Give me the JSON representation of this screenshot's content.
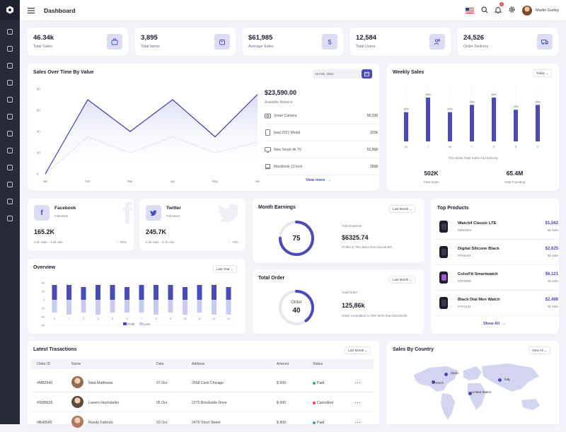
{
  "header": {
    "title": "Dashboard",
    "user_name": "Martin Gurley",
    "notif_count": "4"
  },
  "sidebar": {
    "icons": [
      "monitor-icon",
      "grid-icon",
      "layout-icon",
      "briefcase-icon",
      "pen-icon",
      "database-icon",
      "pie-chart-icon",
      "feather-icon",
      "map-pin-icon",
      "users-icon",
      "archive-icon",
      "share-icon"
    ]
  },
  "stats": [
    {
      "value": "46.34k",
      "label": "Total Sales",
      "icon": "briefcase-icon"
    },
    {
      "value": "3,895",
      "label": "Total Items",
      "icon": "shopping-bag-icon"
    },
    {
      "value": "$61,985",
      "label": "Average Sales",
      "icon": "dollar-icon"
    },
    {
      "value": "12,584",
      "label": "Total Users",
      "icon": "users-icon"
    },
    {
      "value": "24,526",
      "label": "Order Delivery",
      "icon": "truck-icon"
    }
  ],
  "sales_over_time": {
    "title": "Sales Over Time By Value",
    "date": "16 Feb, 2022",
    "balance": "$23,590.00",
    "balance_label": "Available Balance",
    "items": [
      {
        "name": "Smart Camera",
        "value": "56,236",
        "icon": "camera-icon"
      },
      {
        "name": "Ipad 2021 Modal",
        "value": "220k",
        "icon": "tablet-icon"
      },
      {
        "name": "New Smart 4k TV",
        "value": "51,568",
        "icon": "tv-icon"
      },
      {
        "name": "Mackbook 13 inch",
        "value": "1568",
        "icon": "laptop-icon"
      }
    ],
    "view_more": "View more"
  },
  "weekly_sales": {
    "title": "Weekly Sales",
    "filter": "Today",
    "caption": "This Week Total Sales And Earning",
    "total_sales": "502K",
    "total_sales_label": "Total Sales",
    "total_founding": "65.4M",
    "total_founding_label": "Total Founding"
  },
  "facebook": {
    "name": "Facebook",
    "sub": "Followers",
    "value": "165.2K",
    "detail": "3.2k Sale - 4.2k Like",
    "pct": "50%"
  },
  "twitter": {
    "name": "Twitter",
    "sub": "Followers",
    "value": "245.7K",
    "detail": "3.1k Sale - 3.7k Like",
    "pct": "70%"
  },
  "month_earnings": {
    "title": "Month Earnings",
    "filter": "Last Month",
    "gauge": "75",
    "label": "Total Expense",
    "value": "$6325.74",
    "note": "Profile is 75% More than last Month",
    "progress": 0.75
  },
  "total_order": {
    "title": "Total Order",
    "filter": "Last Month",
    "gauge_label": "Order",
    "gauge": "40",
    "label": "Total Order",
    "value": "125,86k",
    "note": "Order Complated is 40% More than last Month",
    "progress": 0.4
  },
  "top_products": {
    "title": "Top Products",
    "items": [
      {
        "name": "Watch4 Classic LTE",
        "code": "#MS5624",
        "price": "$1,562",
        "sale": "5k Sale"
      },
      {
        "name": "Digital Silicone Black",
        "code": "#FD5264",
        "price": "$2,625",
        "sale": "6k Sale"
      },
      {
        "name": "ColorFit Smartwatch",
        "code": "#DF8568",
        "price": "$6,121",
        "sale": "1k Sale"
      },
      {
        "name": "Black Dial Men Watch",
        "code": "#AP1243",
        "price": "$2,468",
        "sale": "3k Sale"
      }
    ],
    "show_all": "Show All"
  },
  "overview": {
    "title": "Overview",
    "filter": "Last Year",
    "legend_profit": "Profit",
    "legend_loss": "Loss"
  },
  "transactions": {
    "title": "Latest Trasactions",
    "filter": "Last Month",
    "columns": [
      "Order ID",
      "Name",
      "Date",
      "Address",
      "Amount",
      "Status"
    ],
    "rows": [
      {
        "id": "#MB2540",
        "name": "Neal Matthews",
        "date": "07 Oct",
        "address": "2558 Cecil Chicago",
        "amount": "$ 500",
        "status": "Paid",
        "status_color": "#2fb56b"
      },
      {
        "id": "#SM5625",
        "name": "Lavern Hochstetler",
        "date": "05 Oct",
        "address": "2270 Brookside Drive",
        "amount": "$ 600",
        "status": "Cancelled",
        "status_color": "#e74c3c"
      },
      {
        "id": "#BH8545",
        "name": "Randy Fabrizio",
        "date": "03 Oct",
        "address": "2470 Short Street",
        "amount": "$ 800",
        "status": "Paid",
        "status_color": "#2fb56b"
      }
    ]
  },
  "sales_by_country": {
    "title": "Sales By Country",
    "filter": "View All",
    "countries": [
      "Spain",
      "Italy",
      "French",
      "United States"
    ]
  },
  "chart_data": [
    {
      "type": "line",
      "title": "Sales Over Time By Value",
      "x": [
        "Jan",
        "Feb",
        "Mar",
        "Apr",
        "May",
        "Jun"
      ],
      "series": [
        {
          "values": [
            0,
            70,
            40,
            70,
            35,
            75
          ]
        },
        {
          "values": [
            0,
            35,
            20,
            35,
            20,
            30
          ]
        }
      ],
      "ylim": [
        0,
        80
      ],
      "yticks": [
        0,
        20,
        40,
        60,
        80
      ]
    },
    {
      "type": "bar",
      "title": "Weekly Sales",
      "categories": [
        "M",
        "T",
        "W",
        "T",
        "F",
        "S",
        "S"
      ],
      "values": [
        12,
        18,
        12,
        15,
        18,
        13,
        15
      ],
      "labels": [
        "12%",
        "18%",
        "12%",
        "15%",
        "18%",
        "13%",
        "15%"
      ]
    },
    {
      "type": "bar",
      "title": "Overview",
      "categories": [
        "1",
        "2",
        "3",
        "4",
        "5",
        "6",
        "7",
        "8",
        "9",
        "10",
        "11",
        "12",
        "13"
      ],
      "series": [
        {
          "name": "Profit",
          "values": [
            35,
            35,
            30,
            35,
            35,
            30,
            35,
            35,
            35,
            30,
            35,
            35,
            30
          ]
        },
        {
          "name": "Loss",
          "values": [
            -30,
            -35,
            -30,
            -35,
            -30,
            -30,
            -30,
            -35,
            -30,
            -35,
            -30,
            -35,
            -35
          ]
        }
      ],
      "ylim": [
        -60,
        60
      ],
      "yticks": [
        60,
        40,
        20,
        0,
        -20,
        -40,
        -60
      ]
    }
  ]
}
